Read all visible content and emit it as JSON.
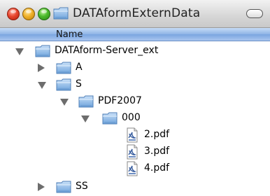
{
  "window": {
    "title": "DATAformExternData",
    "colors": {
      "header_blue": "#8fb4e6",
      "folder_blue": "#6fa4dc",
      "close": "#e8472f",
      "minimize": "#f0b22a",
      "zoom": "#4cbb2c"
    }
  },
  "column": {
    "name_label": "Name"
  },
  "tree": {
    "root": {
      "label": "DATAform-Server_ext",
      "expanded": true
    },
    "a": {
      "label": "A",
      "expanded": false
    },
    "s": {
      "label": "S",
      "expanded": true
    },
    "pdf2007": {
      "label": "PDF2007",
      "expanded": true
    },
    "f000": {
      "label": "000",
      "expanded": true
    },
    "file2": {
      "label": "2.pdf",
      "icon": "pdf-file-icon"
    },
    "file3": {
      "label": "3.pdf",
      "icon": "pdf-file-icon"
    },
    "file4": {
      "label": "4.pdf",
      "icon": "pdf-file-icon"
    },
    "ss": {
      "label": "SS",
      "expanded": false
    }
  }
}
